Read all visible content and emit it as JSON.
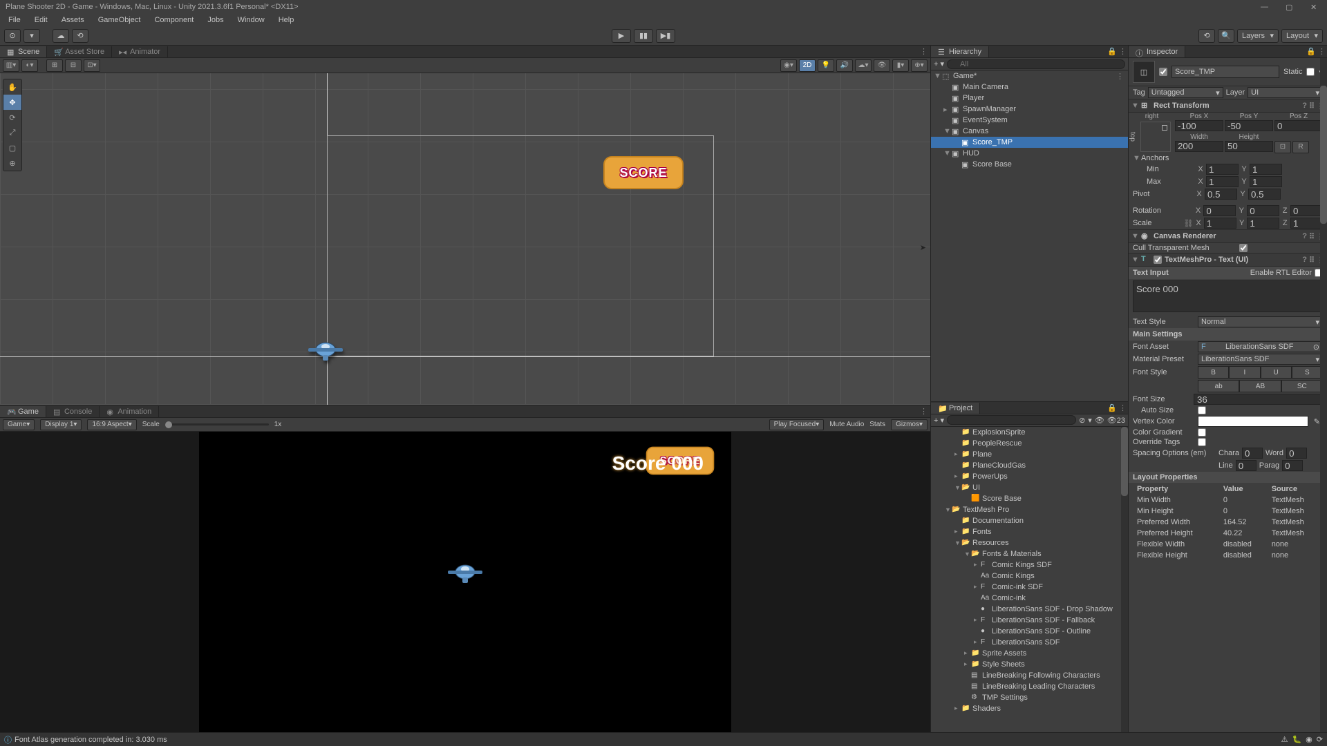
{
  "titlebar": "Plane Shooter 2D - Game - Windows, Mac, Linux - Unity 2021.3.6f1 Personal* <DX11>",
  "menu": [
    "File",
    "Edit",
    "Assets",
    "GameObject",
    "Component",
    "Jobs",
    "Window",
    "Help"
  ],
  "toolbar": {
    "layers": "Layers",
    "layout": "Layout"
  },
  "scene_tabs": [
    "Scene",
    "Asset Store",
    "Animator"
  ],
  "scene_toolbar": {
    "mode_2d": "2D"
  },
  "scene": {
    "score_badge_text": "SCORE"
  },
  "game_tabs": [
    "Game",
    "Console",
    "Animation"
  ],
  "game_toolbar": {
    "game": "Game",
    "display": "Display 1",
    "aspect": "16:9 Aspect",
    "scale": "Scale",
    "scale_value": "1x",
    "play_focused": "Play Focused",
    "mute": "Mute Audio",
    "stats": "Stats",
    "gizmos": "Gizmos"
  },
  "game_view": {
    "score_text": "Score 000",
    "badge_text": "SCORE"
  },
  "hierarchy": {
    "title": "Hierarchy",
    "search_placeholder": "All",
    "items": [
      {
        "name": "Game*",
        "indent": 0,
        "foldout": "▼",
        "icon": "⬚"
      },
      {
        "name": "Main Camera",
        "indent": 1,
        "icon": "▣"
      },
      {
        "name": "Player",
        "indent": 1,
        "icon": "▣"
      },
      {
        "name": "SpawnManager",
        "indent": 1,
        "foldout": "▸",
        "icon": "▣"
      },
      {
        "name": "EventSystem",
        "indent": 1,
        "icon": "▣"
      },
      {
        "name": "Canvas",
        "indent": 1,
        "foldout": "▼",
        "icon": "▣"
      },
      {
        "name": "Score_TMP",
        "indent": 2,
        "icon": "▣",
        "selected": true
      },
      {
        "name": "HUD",
        "indent": 1,
        "foldout": "▼",
        "icon": "▣"
      },
      {
        "name": "Score Base",
        "indent": 2,
        "icon": "▣"
      }
    ]
  },
  "project": {
    "title": "Project",
    "fav_count": "23",
    "items": [
      {
        "name": "ExplosionSprite",
        "indent": 3,
        "icon": "📁"
      },
      {
        "name": "PeopleRescue",
        "indent": 3,
        "icon": "📁"
      },
      {
        "name": "Plane",
        "indent": 3,
        "icon": "📁",
        "foldout": "▸"
      },
      {
        "name": "PlaneCloudGas",
        "indent": 3,
        "icon": "📁"
      },
      {
        "name": "PowerUps",
        "indent": 3,
        "icon": "📁",
        "foldout": "▸"
      },
      {
        "name": "UI",
        "indent": 3,
        "icon": "📂",
        "foldout": "▼"
      },
      {
        "name": "Score Base",
        "indent": 4,
        "icon": "🟧"
      },
      {
        "name": "TextMesh Pro",
        "indent": 2,
        "icon": "📂",
        "foldout": "▼"
      },
      {
        "name": "Documentation",
        "indent": 3,
        "icon": "📁"
      },
      {
        "name": "Fonts",
        "indent": 3,
        "icon": "📁",
        "foldout": "▸"
      },
      {
        "name": "Resources",
        "indent": 3,
        "icon": "📂",
        "foldout": "▼"
      },
      {
        "name": "Fonts & Materials",
        "indent": 4,
        "icon": "📂",
        "foldout": "▼"
      },
      {
        "name": "Comic Kings SDF",
        "indent": 5,
        "icon": "F",
        "foldout": "▸"
      },
      {
        "name": "Comic Kings",
        "indent": 5,
        "icon": "Aa"
      },
      {
        "name": "Comic-ink SDF",
        "indent": 5,
        "icon": "F",
        "foldout": "▸"
      },
      {
        "name": "Comic-ink",
        "indent": 5,
        "icon": "Aa"
      },
      {
        "name": "LiberationSans SDF - Drop Shadow",
        "indent": 5,
        "icon": "●"
      },
      {
        "name": "LiberationSans SDF - Fallback",
        "indent": 5,
        "icon": "F",
        "foldout": "▸"
      },
      {
        "name": "LiberationSans SDF - Outline",
        "indent": 5,
        "icon": "●"
      },
      {
        "name": "LiberationSans SDF",
        "indent": 5,
        "icon": "F",
        "foldout": "▸"
      },
      {
        "name": "Sprite Assets",
        "indent": 4,
        "icon": "📁",
        "foldout": "▸"
      },
      {
        "name": "Style Sheets",
        "indent": 4,
        "icon": "📁",
        "foldout": "▸"
      },
      {
        "name": "LineBreaking Following Characters",
        "indent": 4,
        "icon": "▤"
      },
      {
        "name": "LineBreaking Leading Characters",
        "indent": 4,
        "icon": "▤"
      },
      {
        "name": "TMP Settings",
        "indent": 4,
        "icon": "⚙"
      },
      {
        "name": "Shaders",
        "indent": 3,
        "icon": "📁",
        "foldout": "▸"
      }
    ]
  },
  "inspector": {
    "title": "Inspector",
    "go_name": "Score_TMP",
    "static": "Static",
    "tag_label": "Tag",
    "tag_value": "Untagged",
    "layer_label": "Layer",
    "layer_value": "UI",
    "rect_transform": {
      "title": "Rect Transform",
      "anchor_preset_top": "right",
      "anchor_preset_side": "top",
      "posx_label": "Pos X",
      "posx": "-100",
      "posy_label": "Pos Y",
      "posy": "-50",
      "posz_label": "Pos Z",
      "posz": "0",
      "width_label": "Width",
      "width": "200",
      "height_label": "Height",
      "height": "50",
      "anchors": "Anchors",
      "min": "Min",
      "min_x": "1",
      "min_y": "1",
      "max": "Max",
      "max_x": "1",
      "max_y": "1",
      "pivot": "Pivot",
      "pivot_x": "0.5",
      "pivot_y": "0.5",
      "rotation": "Rotation",
      "rot_x": "0",
      "rot_y": "0",
      "rot_z": "0",
      "scale": "Scale",
      "scale_x": "1",
      "scale_y": "1",
      "scale_z": "1"
    },
    "canvas_renderer": {
      "title": "Canvas Renderer",
      "cull": "Cull Transparent Mesh"
    },
    "tmp": {
      "title": "TextMeshPro - Text (UI)",
      "text_input_label": "Text Input",
      "rtl": "Enable RTL Editor",
      "text_value": "Score 000",
      "text_style_label": "Text Style",
      "text_style": "Normal",
      "main_settings": "Main Settings",
      "font_asset_label": "Font Asset",
      "font_asset": "LiberationSans SDF",
      "material_label": "Material Preset",
      "material": "LiberationSans SDF",
      "font_style_label": "Font Style",
      "styles": {
        "b": "B",
        "i": "I",
        "u": "U",
        "s": "S",
        "ab": "ab",
        "AB": "AB",
        "SC": "SC"
      },
      "font_size_label": "Font Size",
      "font_size": "36",
      "auto_size": "Auto Size",
      "vertex_color": "Vertex Color",
      "color_gradient": "Color Gradient",
      "override_tags": "Override Tags",
      "spacing": "Spacing Options (em)",
      "chara": "Chara",
      "chara_v": "0",
      "word": "Word",
      "word_v": "0",
      "line": "Line",
      "line_v": "0",
      "parag": "Parag",
      "parag_v": "0"
    },
    "layout": {
      "title": "Layout Properties",
      "headers": [
        "Property",
        "Value",
        "Source"
      ],
      "rows": [
        [
          "Min Width",
          "0",
          "TextMesh"
        ],
        [
          "Min Height",
          "0",
          "TextMesh"
        ],
        [
          "Preferred Width",
          "164.52",
          "TextMesh"
        ],
        [
          "Preferred Height",
          "40.22",
          "TextMesh"
        ],
        [
          "Flexible Width",
          "disabled",
          "none"
        ],
        [
          "Flexible Height",
          "disabled",
          "none"
        ]
      ]
    }
  },
  "statusbar": {
    "message": "Font Atlas generation completed in: 3.030 ms"
  }
}
